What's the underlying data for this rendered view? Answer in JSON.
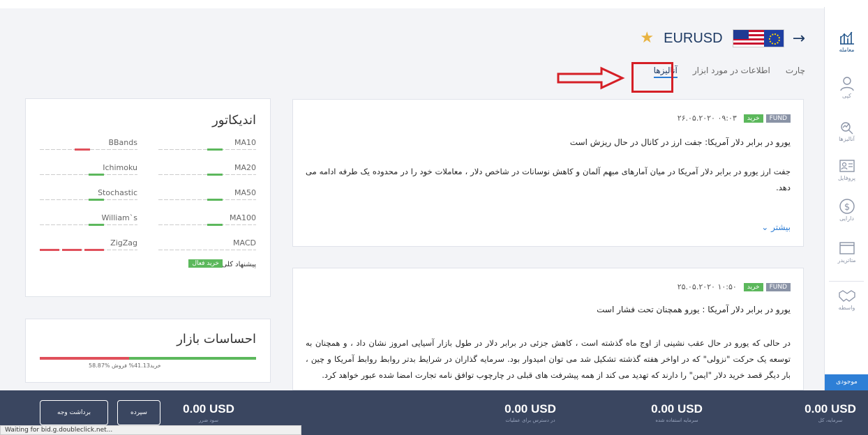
{
  "header": {
    "symbol": "EURUSD"
  },
  "tabs": [
    {
      "label": "چارت"
    },
    {
      "label": "اطلاعات در مورد ابزار"
    },
    {
      "label": "آنالیزها"
    }
  ],
  "sidebar": {
    "items": [
      {
        "label": "معامله",
        "icon": "trade-chart-icon"
      },
      {
        "label": "کپی",
        "icon": "copy-user-icon"
      },
      {
        "label": "آنالیزها",
        "icon": "analysis-icon"
      },
      {
        "label": "پروفایل",
        "icon": "profile-card-icon"
      },
      {
        "label": "دارایی",
        "icon": "dollar-icon"
      },
      {
        "label": "متاتریدر",
        "icon": "window-icon"
      },
      {
        "label": "واسطه",
        "icon": "handshake-icon"
      }
    ],
    "online_label": "موجودی"
  },
  "news": [
    {
      "tag": "FUND",
      "signal": "خرید",
      "time": "۰۹:۰۳ ۲۶.۰۵.۲۰۲۰",
      "title": "یورو در برابر دلار آمریکا: جفت ارز در کانال در حال ریزش است",
      "body": "جفت ارز یورو در برابر دلار آمریکا در میان آمارهای مبهم آلمان و کاهش نوسانات در شاخص دلار ، معاملات خود را در محدوده یک طرفه ادامه می دهد.",
      "more": "بیشتر"
    },
    {
      "tag": "FUND",
      "signal": "خرید",
      "time": "۱۰:۵۰ ۲۵.۰۵.۲۰۲۰",
      "title": "یورو در برابر دلار آمریکا : یورو همچنان تحت فشار است",
      "body": "در حالی که یورو در حال عقب نشینی از اوج ماه گذشته است ، کاهش جزئی در برابر دلار در طول بازار آسیایی امروز نشان داد ، و همچنان به توسعه یک حرکت \"نزولی\" که در اواخر هفته گذشته تشکیل شد می توان امیدوار بود. سرمایه گذاران در شرایط بدتر روابط روابط آمریکا و چین ، بار دیگر قصد خرید دلار \"ایمن\" را دارند که تهدید می کند از همه پیشرفت های قبلی در چارچوب توافق نامه تجارت امضا شده عبور خواهد کرد."
    }
  ],
  "indicators": {
    "title": "اندیکاتور",
    "suggest_label": "پیشنهاد کلی",
    "suggest_value": "خرید فعال",
    "items": [
      {
        "name": "MA10",
        "signal": "buy"
      },
      {
        "name": "BBands",
        "signal": "sell"
      },
      {
        "name": "MA20",
        "signal": "buy"
      },
      {
        "name": "Ichimoku",
        "signal": "buy"
      },
      {
        "name": "MA50",
        "signal": "buy"
      },
      {
        "name": "Stochastic",
        "signal": "buy"
      },
      {
        "name": "MA100",
        "signal": "buy"
      },
      {
        "name": "William`s",
        "signal": "buy"
      },
      {
        "name": "MACD",
        "signal": "neutral"
      },
      {
        "name": "ZigZag",
        "signal": "sell"
      }
    ]
  },
  "sentiment": {
    "title": "احساسات بازار",
    "buy_pct": 58.87,
    "sell_pct": 41.13,
    "text": "58.87% خرید41.13% فروش"
  },
  "balances": [
    {
      "value": "0.00 USD",
      "label": "سرمایه، کل"
    },
    {
      "value": "0.00 USD",
      "label": "سرمایه استفاده شده"
    },
    {
      "value": "0.00 USD",
      "label": "در دسترس برای عملیات"
    },
    {
      "value": "0.00 USD",
      "label": "سود ضرر"
    }
  ],
  "buttons": {
    "deposit": "سپرده",
    "withdraw": "برداشت وجه"
  },
  "status": "Waiting for bid.g.doubleclick.net..."
}
